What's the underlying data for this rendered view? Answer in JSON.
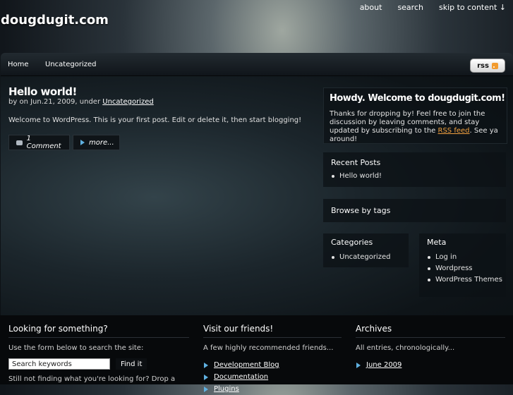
{
  "site": {
    "title": "dougdugit.com"
  },
  "top_links": [
    "about",
    "search",
    "skip to content ↓"
  ],
  "nav": {
    "items": [
      "Home",
      "Uncategorized"
    ],
    "rss_label": "rss"
  },
  "post": {
    "title": "Hello world!",
    "meta_prefix": "by on Jun.21, 2009, under",
    "meta_category": "Uncategorized",
    "body": "Welcome to WordPress. This is your first post. Edit or delete it, then start blogging!",
    "comments_label": "1 Comment",
    "more_label": "more..."
  },
  "welcome": {
    "title": "Howdy. Welcome to dougdugit.com!",
    "text_before": "Thanks for dropping by! Feel free to join the discussion by leaving comments, and stay updated by subscribing to the",
    "link": "RSS feed",
    "text_after": ". See ya around!"
  },
  "recent_posts": {
    "title": "Recent Posts",
    "items": [
      "Hello world!"
    ]
  },
  "tags": {
    "title": "Browse by tags"
  },
  "categories": {
    "title": "Categories",
    "items": [
      "Uncategorized"
    ]
  },
  "meta": {
    "title": "Meta",
    "items": [
      "Log in",
      "Wordpress",
      "WordPress Themes"
    ]
  },
  "footer": {
    "search": {
      "title": "Looking for something?",
      "subtitle": "Use the form below to search the site:",
      "placeholder": "Search keywords",
      "button": "Find it",
      "still": "Still not finding what you're looking for? Drop a"
    },
    "friends": {
      "title": "Visit our friends!",
      "subtitle": "A few highly recommended friends...",
      "links": [
        "Development Blog",
        "Documentation",
        "Plugins"
      ]
    },
    "archives": {
      "title": "Archives",
      "subtitle": "All entries, chronologically...",
      "links": [
        "June 2009"
      ]
    }
  }
}
